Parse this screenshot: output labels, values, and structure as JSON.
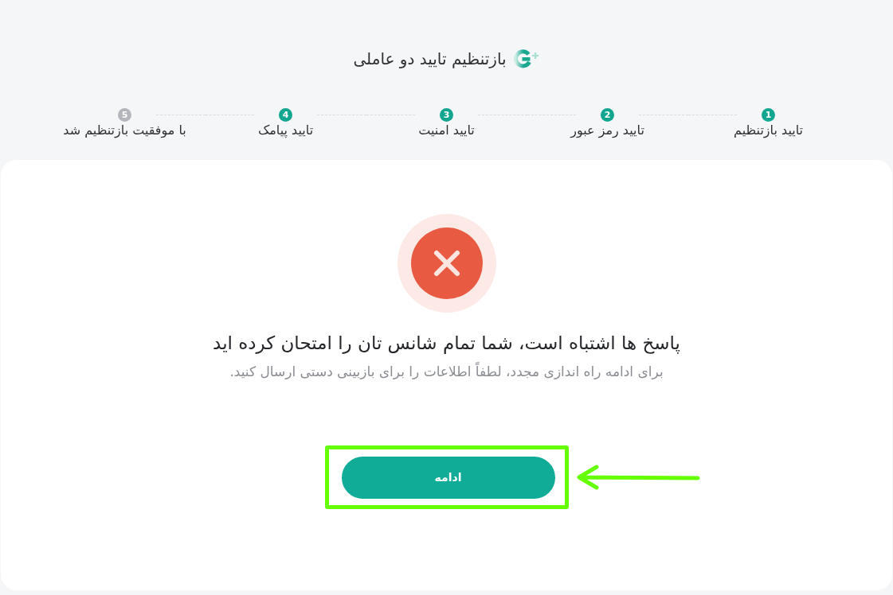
{
  "header": {
    "title": "بازتنظیم تایید دو عاملی"
  },
  "steps": [
    {
      "number": "1",
      "label": "تایید بازتنظیم",
      "completed": true
    },
    {
      "number": "2",
      "label": "تایید رمز عبور",
      "completed": true
    },
    {
      "number": "3",
      "label": "تایید امنیت",
      "completed": true
    },
    {
      "number": "4",
      "label": "تایید پیامک",
      "completed": true
    },
    {
      "number": "5",
      "label": "با موفقیت بازتنظیم شد",
      "completed": false
    }
  ],
  "result": {
    "kind": "error",
    "title": "پاسخ ها اشتباه است، شما تمام شانس تان را امتحان کرده اید",
    "message": "برای ادامه راه اندازی مجدد، لطفاً اطلاعات را برای بازبینی دستی ارسال کنید."
  },
  "button": {
    "label": "ادامه",
    "highlighted": true
  }
}
